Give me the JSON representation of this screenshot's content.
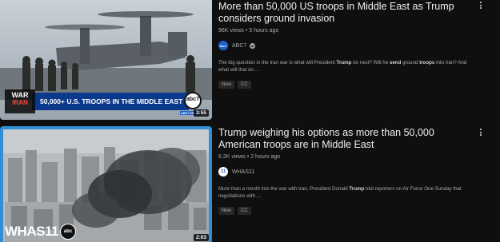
{
  "results": [
    {
      "title": "More than 50,000 US troops in Middle East as Trump considers ground invasion",
      "views": "96K views",
      "age": "5 hours ago",
      "channel": "ABC7",
      "channel_logo_text": "abc7",
      "snippet_parts": [
        "The big question in the Iran war is what will President ",
        "Trump",
        " do next? Will he ",
        "send",
        " ground ",
        "troops",
        " into Iran? And what will that do ..."
      ],
      "badges": [
        "New",
        "CC"
      ],
      "duration": "3:55",
      "thumb_lower_third": "50,000+ U.S. TROOPS IN THE MIDDLE EAST",
      "thumb_logo_top": "WAR",
      "thumb_logo_bottom": "IRAN",
      "thumb_corner_logo": "abc7",
      "thumb_corner_sub": "ABC7 NEWS"
    },
    {
      "title": "Trump weighing his options as more than 50,000 American troops are in Middle East",
      "views": "6.2K views",
      "age": "2 hours ago",
      "channel": "WHAS11",
      "channel_logo_text": "11",
      "snippet_parts": [
        "More than a month into the war with Iran, President Donald ",
        "Trump",
        " told reporters on Air Force One Sunday that negotiations with ..."
      ],
      "badges": [
        "New",
        "CC"
      ],
      "duration": "2:03",
      "thumb_watermark": "WHAS11",
      "thumb_watermark_abc": "abc"
    }
  ],
  "colors": {
    "background": "#0f0f0f",
    "title": "#f1f1f1",
    "meta": "#aaaaaa",
    "abc_blue": "#1d5fd1",
    "lower_third_blue": "#0b3a8c"
  },
  "icons": [
    "more-vert-icon",
    "verified-check-icon"
  ]
}
